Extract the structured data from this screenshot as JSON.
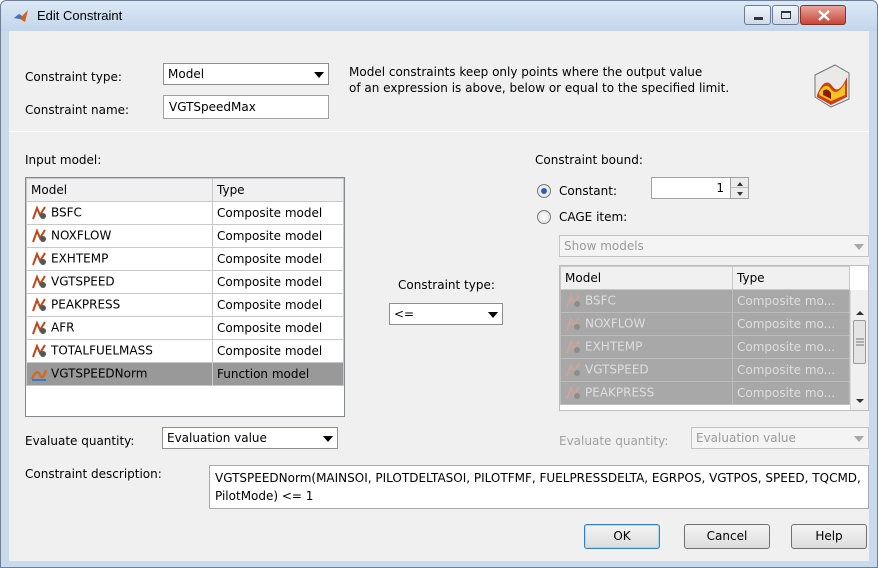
{
  "window": {
    "title": "Edit Constraint"
  },
  "top": {
    "constraint_type_label": "Constraint type:",
    "constraint_type_value": "Model",
    "constraint_name_label": "Constraint name:",
    "constraint_name_value": "VGTSpeedMax",
    "description_line1": "Model constraints keep only points where the output value",
    "description_line2": "of an expression is above, below or equal to the specified limit."
  },
  "input_model": {
    "label": "Input model:",
    "columns": [
      "Model",
      "Type"
    ],
    "rows": [
      {
        "model": "BSFC",
        "type": "Composite model"
      },
      {
        "model": "NOXFLOW",
        "type": "Composite model"
      },
      {
        "model": "EXHTEMP",
        "type": "Composite model"
      },
      {
        "model": "VGTSPEED",
        "type": "Composite model"
      },
      {
        "model": "PEAKPRESS",
        "type": "Composite model"
      },
      {
        "model": "AFR",
        "type": "Composite model"
      },
      {
        "model": "TOTALFUELMASS",
        "type": "Composite model"
      },
      {
        "model": "VGTSPEEDNorm",
        "type": "Function model"
      }
    ],
    "selected_index": 7
  },
  "middle": {
    "constraint_type_label": "Constraint type:",
    "operator_value": "<="
  },
  "bound": {
    "label": "Constraint bound:",
    "constant_label": "Constant:",
    "constant_value": "1",
    "cage_item_label": "CAGE item:",
    "show_models_value": "Show models",
    "columns": [
      "Model",
      "Type"
    ],
    "rows": [
      {
        "model": "BSFC",
        "type": "Composite mo..."
      },
      {
        "model": "NOXFLOW",
        "type": "Composite mo..."
      },
      {
        "model": "EXHTEMP",
        "type": "Composite mo..."
      },
      {
        "model": "VGTSPEED",
        "type": "Composite mo..."
      },
      {
        "model": "PEAKPRESS",
        "type": "Composite mo..."
      }
    ],
    "evaluate_quantity_label": "Evaluate quantity:",
    "evaluate_quantity_value": "Evaluation value"
  },
  "left_eval": {
    "label": "Evaluate quantity:",
    "value": "Evaluation value"
  },
  "description": {
    "label": "Constraint description:",
    "text": "VGTSPEEDNorm(MAINSOI, PILOTDELTASOI, PILOTFMF, FUELPRESSDELTA, EGRPOS, VGTPOS, SPEED, TQCMD, PilotMode) <= 1"
  },
  "buttons": {
    "ok": "OK",
    "cancel": "Cancel",
    "help": "Help"
  },
  "colors": {
    "selection_row": "#999999",
    "disabled_row": "#a8a8a8",
    "close_button": "#c8453a"
  }
}
